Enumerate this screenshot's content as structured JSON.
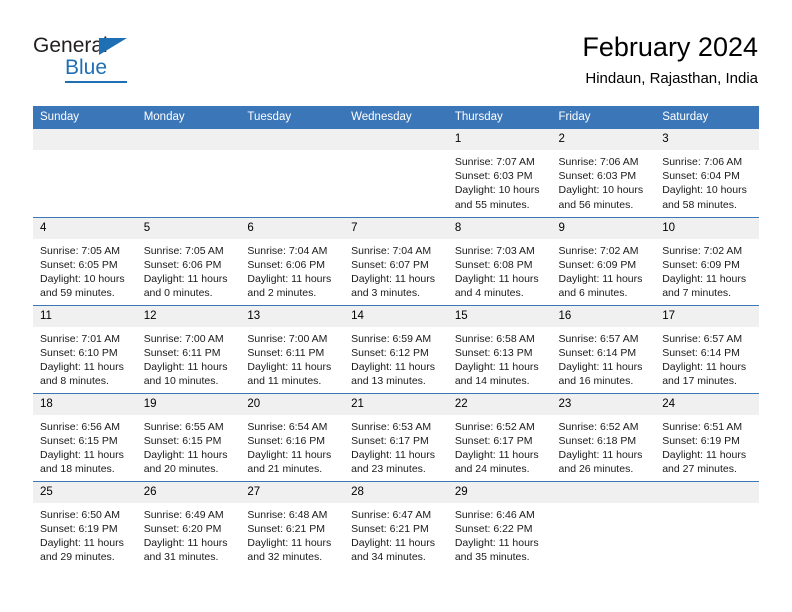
{
  "brand": {
    "name_part1": "General",
    "name_part2": "Blue",
    "logo_icon": "blue-triangle-flag"
  },
  "header": {
    "title": "February 2024",
    "subtitle": "Hindaun, Rajasthan, India"
  },
  "colors": {
    "header_blue": "#3b76b8",
    "brand_blue": "#1f6fb4",
    "daynum_band": "#f0f0f0",
    "text": "#000000"
  },
  "weekday_headers": [
    "Sunday",
    "Monday",
    "Tuesday",
    "Wednesday",
    "Thursday",
    "Friday",
    "Saturday"
  ],
  "weeks": [
    [
      {
        "day": "",
        "empty": true,
        "sunrise": "",
        "sunset": "",
        "daylight1": "",
        "daylight2": ""
      },
      {
        "day": "",
        "empty": true,
        "sunrise": "",
        "sunset": "",
        "daylight1": "",
        "daylight2": ""
      },
      {
        "day": "",
        "empty": true,
        "sunrise": "",
        "sunset": "",
        "daylight1": "",
        "daylight2": ""
      },
      {
        "day": "",
        "empty": true,
        "sunrise": "",
        "sunset": "",
        "daylight1": "",
        "daylight2": ""
      },
      {
        "day": "1",
        "sunrise": "Sunrise: 7:07 AM",
        "sunset": "Sunset: 6:03 PM",
        "daylight1": "Daylight: 10 hours",
        "daylight2": "and 55 minutes."
      },
      {
        "day": "2",
        "sunrise": "Sunrise: 7:06 AM",
        "sunset": "Sunset: 6:03 PM",
        "daylight1": "Daylight: 10 hours",
        "daylight2": "and 56 minutes."
      },
      {
        "day": "3",
        "sunrise": "Sunrise: 7:06 AM",
        "sunset": "Sunset: 6:04 PM",
        "daylight1": "Daylight: 10 hours",
        "daylight2": "and 58 minutes."
      }
    ],
    [
      {
        "day": "4",
        "sunrise": "Sunrise: 7:05 AM",
        "sunset": "Sunset: 6:05 PM",
        "daylight1": "Daylight: 10 hours",
        "daylight2": "and 59 minutes."
      },
      {
        "day": "5",
        "sunrise": "Sunrise: 7:05 AM",
        "sunset": "Sunset: 6:06 PM",
        "daylight1": "Daylight: 11 hours",
        "daylight2": "and 0 minutes."
      },
      {
        "day": "6",
        "sunrise": "Sunrise: 7:04 AM",
        "sunset": "Sunset: 6:06 PM",
        "daylight1": "Daylight: 11 hours",
        "daylight2": "and 2 minutes."
      },
      {
        "day": "7",
        "sunrise": "Sunrise: 7:04 AM",
        "sunset": "Sunset: 6:07 PM",
        "daylight1": "Daylight: 11 hours",
        "daylight2": "and 3 minutes."
      },
      {
        "day": "8",
        "sunrise": "Sunrise: 7:03 AM",
        "sunset": "Sunset: 6:08 PM",
        "daylight1": "Daylight: 11 hours",
        "daylight2": "and 4 minutes."
      },
      {
        "day": "9",
        "sunrise": "Sunrise: 7:02 AM",
        "sunset": "Sunset: 6:09 PM",
        "daylight1": "Daylight: 11 hours",
        "daylight2": "and 6 minutes."
      },
      {
        "day": "10",
        "sunrise": "Sunrise: 7:02 AM",
        "sunset": "Sunset: 6:09 PM",
        "daylight1": "Daylight: 11 hours",
        "daylight2": "and 7 minutes."
      }
    ],
    [
      {
        "day": "11",
        "sunrise": "Sunrise: 7:01 AM",
        "sunset": "Sunset: 6:10 PM",
        "daylight1": "Daylight: 11 hours",
        "daylight2": "and 8 minutes."
      },
      {
        "day": "12",
        "sunrise": "Sunrise: 7:00 AM",
        "sunset": "Sunset: 6:11 PM",
        "daylight1": "Daylight: 11 hours",
        "daylight2": "and 10 minutes."
      },
      {
        "day": "13",
        "sunrise": "Sunrise: 7:00 AM",
        "sunset": "Sunset: 6:11 PM",
        "daylight1": "Daylight: 11 hours",
        "daylight2": "and 11 minutes."
      },
      {
        "day": "14",
        "sunrise": "Sunrise: 6:59 AM",
        "sunset": "Sunset: 6:12 PM",
        "daylight1": "Daylight: 11 hours",
        "daylight2": "and 13 minutes."
      },
      {
        "day": "15",
        "sunrise": "Sunrise: 6:58 AM",
        "sunset": "Sunset: 6:13 PM",
        "daylight1": "Daylight: 11 hours",
        "daylight2": "and 14 minutes."
      },
      {
        "day": "16",
        "sunrise": "Sunrise: 6:57 AM",
        "sunset": "Sunset: 6:14 PM",
        "daylight1": "Daylight: 11 hours",
        "daylight2": "and 16 minutes."
      },
      {
        "day": "17",
        "sunrise": "Sunrise: 6:57 AM",
        "sunset": "Sunset: 6:14 PM",
        "daylight1": "Daylight: 11 hours",
        "daylight2": "and 17 minutes."
      }
    ],
    [
      {
        "day": "18",
        "sunrise": "Sunrise: 6:56 AM",
        "sunset": "Sunset: 6:15 PM",
        "daylight1": "Daylight: 11 hours",
        "daylight2": "and 18 minutes."
      },
      {
        "day": "19",
        "sunrise": "Sunrise: 6:55 AM",
        "sunset": "Sunset: 6:15 PM",
        "daylight1": "Daylight: 11 hours",
        "daylight2": "and 20 minutes."
      },
      {
        "day": "20",
        "sunrise": "Sunrise: 6:54 AM",
        "sunset": "Sunset: 6:16 PM",
        "daylight1": "Daylight: 11 hours",
        "daylight2": "and 21 minutes."
      },
      {
        "day": "21",
        "sunrise": "Sunrise: 6:53 AM",
        "sunset": "Sunset: 6:17 PM",
        "daylight1": "Daylight: 11 hours",
        "daylight2": "and 23 minutes."
      },
      {
        "day": "22",
        "sunrise": "Sunrise: 6:52 AM",
        "sunset": "Sunset: 6:17 PM",
        "daylight1": "Daylight: 11 hours",
        "daylight2": "and 24 minutes."
      },
      {
        "day": "23",
        "sunrise": "Sunrise: 6:52 AM",
        "sunset": "Sunset: 6:18 PM",
        "daylight1": "Daylight: 11 hours",
        "daylight2": "and 26 minutes."
      },
      {
        "day": "24",
        "sunrise": "Sunrise: 6:51 AM",
        "sunset": "Sunset: 6:19 PM",
        "daylight1": "Daylight: 11 hours",
        "daylight2": "and 27 minutes."
      }
    ],
    [
      {
        "day": "25",
        "sunrise": "Sunrise: 6:50 AM",
        "sunset": "Sunset: 6:19 PM",
        "daylight1": "Daylight: 11 hours",
        "daylight2": "and 29 minutes."
      },
      {
        "day": "26",
        "sunrise": "Sunrise: 6:49 AM",
        "sunset": "Sunset: 6:20 PM",
        "daylight1": "Daylight: 11 hours",
        "daylight2": "and 31 minutes."
      },
      {
        "day": "27",
        "sunrise": "Sunrise: 6:48 AM",
        "sunset": "Sunset: 6:21 PM",
        "daylight1": "Daylight: 11 hours",
        "daylight2": "and 32 minutes."
      },
      {
        "day": "28",
        "sunrise": "Sunrise: 6:47 AM",
        "sunset": "Sunset: 6:21 PM",
        "daylight1": "Daylight: 11 hours",
        "daylight2": "and 34 minutes."
      },
      {
        "day": "29",
        "sunrise": "Sunrise: 6:46 AM",
        "sunset": "Sunset: 6:22 PM",
        "daylight1": "Daylight: 11 hours",
        "daylight2": "and 35 minutes."
      },
      {
        "day": "",
        "empty": true,
        "sunrise": "",
        "sunset": "",
        "daylight1": "",
        "daylight2": ""
      },
      {
        "day": "",
        "empty": true,
        "sunrise": "",
        "sunset": "",
        "daylight1": "",
        "daylight2": ""
      }
    ]
  ]
}
